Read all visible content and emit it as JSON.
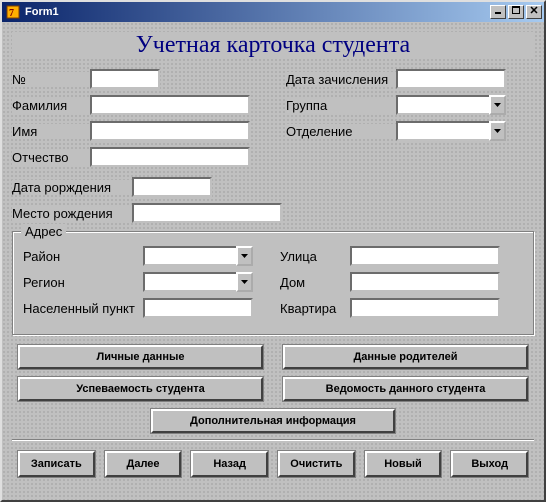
{
  "window": {
    "title": "Form1"
  },
  "heading": "Учетная карточка студента",
  "left": {
    "number_label": "№",
    "surname_label": "Фамилия",
    "name_label": "Имя",
    "patronymic_label": "Отчество",
    "number_value": "",
    "surname_value": "",
    "name_value": "",
    "patronymic_value": ""
  },
  "right": {
    "enroll_date_label": "Дата зачисления",
    "group_label": "Группа",
    "department_label": "Отделение",
    "enroll_date_value": "",
    "group_value": "",
    "department_value": ""
  },
  "long": {
    "birthdate_label": "Дата рорждения",
    "birthplace_label": "Место рождения",
    "birthdate_value": "",
    "birthplace_value": ""
  },
  "address": {
    "group_title": "Адрес",
    "district_label": "Район",
    "region_label": "Регион",
    "locality_label": "Населенный пункт",
    "street_label": "Улица",
    "house_label": "Дом",
    "apartment_label": "Квартира",
    "district_value": "",
    "region_value": "",
    "locality_value": "",
    "street_value": "",
    "house_value": "",
    "apartment_value": ""
  },
  "wide_buttons": {
    "personal": "Личные данные",
    "parents": "Данные родителей",
    "performance": "Успеваемость студента",
    "record": "Ведомость данного студента",
    "extra": "Дополнительная информация"
  },
  "bottom_buttons": {
    "save": "Записать",
    "next": "Далее",
    "back": "Назад",
    "clear": "Очистить",
    "new": "Новый",
    "exit": "Выход"
  }
}
